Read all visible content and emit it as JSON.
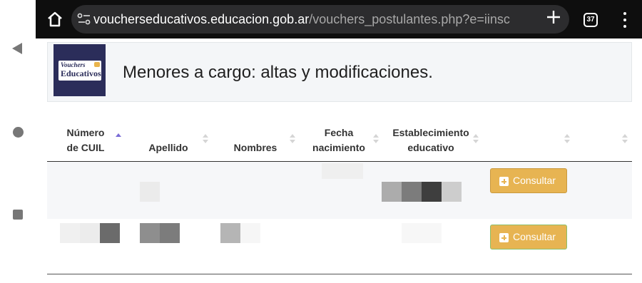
{
  "browser": {
    "url_host": "voucherseducativos.educacion.gob.ar",
    "url_path": "/vouchers_postulantes.php?e=iinsc",
    "tab_count": "37"
  },
  "header": {
    "logo_line1": "Vouchers",
    "logo_line2": "Educativos",
    "title": "Menores a cargo: altas y modificaciones."
  },
  "table": {
    "columns": [
      {
        "line1": "Número",
        "line2": "de CUIL"
      },
      {
        "line1": "",
        "line2": "Apellido"
      },
      {
        "line1": "",
        "line2": "Nombres"
      },
      {
        "line1": "Fecha",
        "line2": "nacimiento"
      },
      {
        "line1": "Establecimiento",
        "line2": "educativo"
      }
    ],
    "rows": [
      {
        "action_label": "Consultar"
      },
      {
        "action_label": "Consultar"
      }
    ]
  },
  "colors": {
    "accent": "#e7b452",
    "toolbar": "#0e0e0e",
    "logo_bg": "#2b2d5a"
  }
}
